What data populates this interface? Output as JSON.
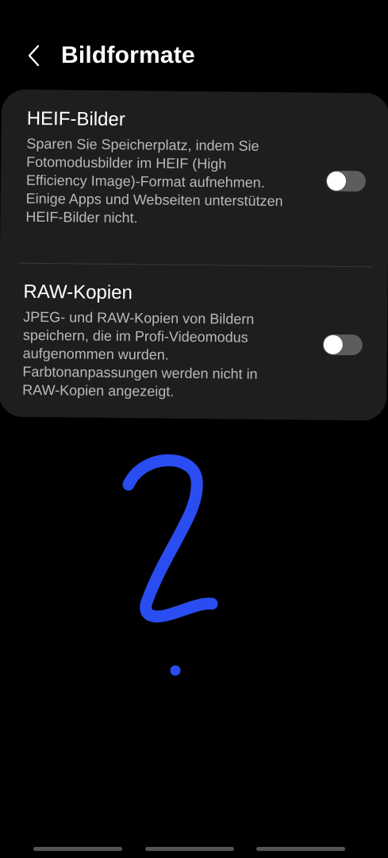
{
  "header": {
    "back_icon": "chevron-left-icon",
    "title": "Bildformate"
  },
  "settings": [
    {
      "title": "HEIF-Bilder",
      "description": "Sparen Sie Speicherplatz, indem Sie Fotomodusbilder im HEIF (High Efficiency Image)-Format aufnehmen. Einige Apps und Webseiten unterstützen HEIF-Bilder nicht.",
      "enabled": false
    },
    {
      "title": "RAW-Kopien",
      "description": "JPEG- und RAW-Kopien von Bildern speichern, die im Profi-Videomodus aufgenommen wurden. Farbtonanpassungen werden nicht in RAW-Kopien angezeigt.",
      "enabled": false
    }
  ],
  "colors": {
    "background": "#000000",
    "card": "#1e1e1e",
    "doodle": "#2a4df2",
    "toggle_off": "#5d5d5d"
  }
}
